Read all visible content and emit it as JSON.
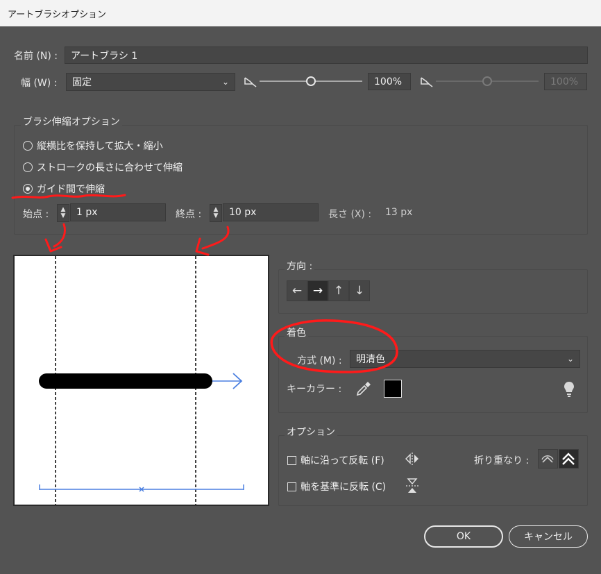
{
  "window": {
    "title": "アートブラシオプション"
  },
  "name_row": {
    "label": "名前 (N) :",
    "value": "アートブラシ 1"
  },
  "width_row": {
    "label": "幅 (W) :",
    "select_value": "固定",
    "slider1_value": "100%",
    "slider1_level": 0.5,
    "slider2_value": "100%"
  },
  "scale_group": {
    "title": "ブラシ伸縮オプション",
    "options": [
      {
        "label": "縦横比を保持して拡大・縮小",
        "selected": false
      },
      {
        "label": "ストロークの長さに合わせて伸縮",
        "selected": false
      },
      {
        "label": "ガイド間で伸縮",
        "selected": true
      }
    ],
    "start_label": "始点 :",
    "start_value": "1 px",
    "end_label": "終点 :",
    "end_value": "10 px",
    "length_label": "長さ (X) :",
    "length_value": "13 px"
  },
  "direction_group": {
    "title": "方向 :",
    "buttons": [
      {
        "glyph": "←",
        "selected": false
      },
      {
        "glyph": "→",
        "selected": true
      },
      {
        "glyph": "↑",
        "selected": false
      },
      {
        "glyph": "↓",
        "selected": false
      }
    ]
  },
  "color_group": {
    "title": "着色",
    "method_label": "方式 (M) :",
    "method_value": "明清色",
    "key_color_label": "キーカラー :",
    "key_color": "#000000"
  },
  "options_group": {
    "title": "オプション",
    "flip_along_label": "軸に沿って反転 (F)",
    "flip_across_label": "軸を基準に反転 (C)",
    "overlap_label": "折り重なり :"
  },
  "buttons": {
    "ok": "OK",
    "cancel": "キャンセル"
  },
  "colors": {
    "annotation": "#ff1a1a",
    "preview_accent": "#4a7fe0"
  }
}
